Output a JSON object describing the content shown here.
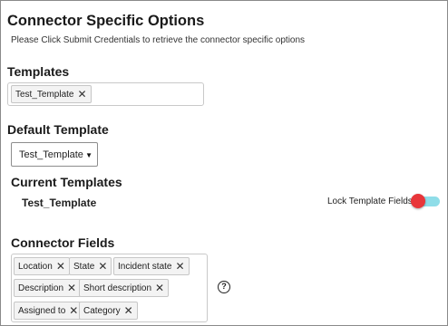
{
  "header": {
    "title": "Connector Specific Options",
    "subtitle": "Please Click Submit Credentials to retrieve the connector specific options"
  },
  "templates": {
    "label": "Templates",
    "chips": [
      "Test_Template"
    ]
  },
  "default_template": {
    "label": "Default Template",
    "selected": "Test_Template"
  },
  "current_templates": {
    "label": "Current Templates",
    "name": "Test_Template",
    "lock_label": "Lock Template Fields",
    "lock_enabled": true
  },
  "connector_fields": {
    "label": "Connector Fields",
    "chips": [
      "Location",
      "State",
      "Incident state",
      "Description",
      "Short description",
      "Assigned to",
      "Category"
    ]
  },
  "icons": {
    "remove": "close-icon",
    "dropdown": "caret-down-icon",
    "help": "help-circle-icon"
  },
  "colors": {
    "toggle_knob": "#e8363a",
    "toggle_track": "#8fdde8"
  }
}
